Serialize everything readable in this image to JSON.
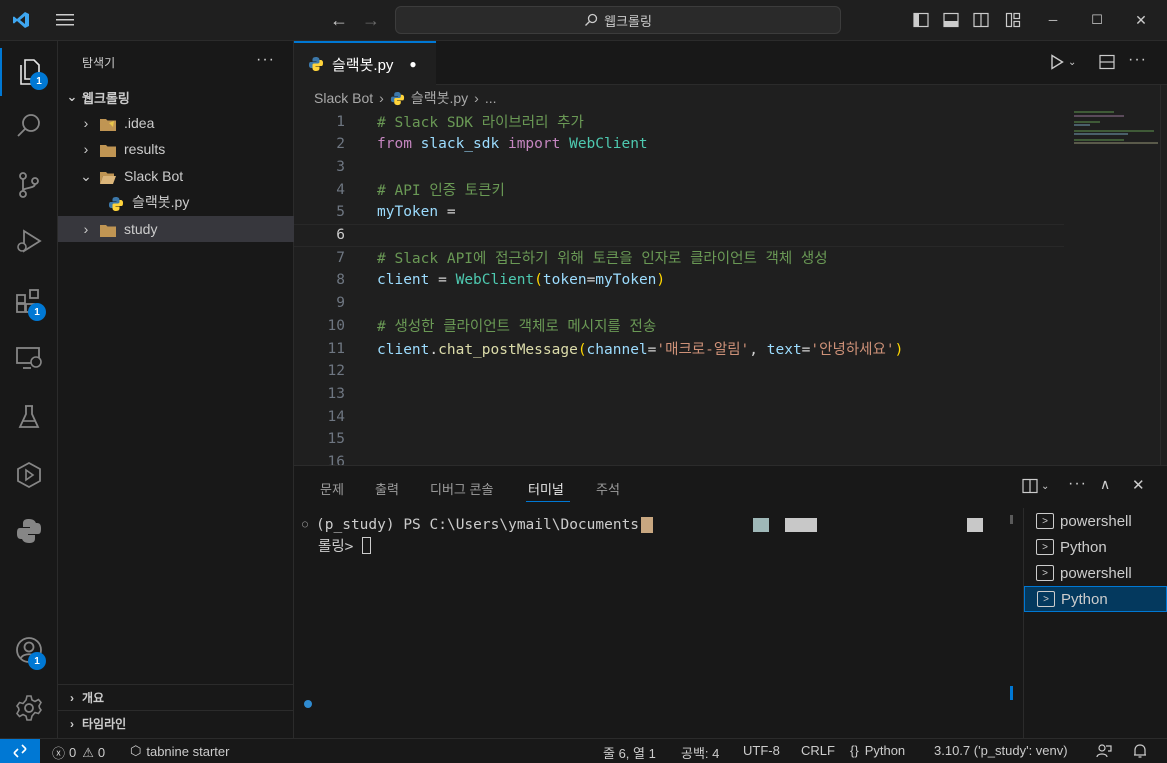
{
  "window": {
    "command_center": "웹크롤링",
    "nav_back": "←",
    "nav_forward": "→",
    "controls": {
      "minimize": "─",
      "maximize": "☐",
      "close": "✕"
    }
  },
  "activity": {
    "explorer_badge": "1",
    "extensions_badge": "1",
    "accounts_badge": "1"
  },
  "sidebar": {
    "title": "탐색기",
    "more": "···",
    "root": "웹크롤링",
    "items": [
      {
        "label": ".idea",
        "chevron": "›"
      },
      {
        "label": "results",
        "chevron": "›"
      },
      {
        "label": "Slack Bot",
        "chevron": "⌄"
      },
      {
        "label": "슬랙봇.py"
      },
      {
        "label": "study",
        "chevron": "›"
      }
    ],
    "sections": {
      "outline": "개요",
      "timeline": "타임라인"
    }
  },
  "editor": {
    "tab": {
      "label": "슬랙봇.py",
      "dirty": "●"
    },
    "breadcrumb": {
      "folder": "Slack Bot",
      "file": "슬랙봇.py",
      "more": "..."
    },
    "lines": [
      {
        "n": "1",
        "tokens": [
          [
            "cmt",
            "# Slack SDK 라이브러리 추가"
          ]
        ]
      },
      {
        "n": "2",
        "tokens": [
          [
            "kw",
            "from"
          ],
          [
            "op",
            " "
          ],
          [
            "var",
            "slack_sdk"
          ],
          [
            "op",
            " "
          ],
          [
            "kw",
            "import"
          ],
          [
            "op",
            " "
          ],
          [
            "cls",
            "WebClient"
          ]
        ]
      },
      {
        "n": "3",
        "tokens": []
      },
      {
        "n": "4",
        "tokens": [
          [
            "cmt",
            "# API 인증 토큰키"
          ]
        ]
      },
      {
        "n": "5",
        "tokens": [
          [
            "var",
            "myToken"
          ],
          [
            "op",
            " ="
          ]
        ]
      },
      {
        "n": "6",
        "tokens": []
      },
      {
        "n": "7",
        "tokens": [
          [
            "cmt",
            "# Slack API에 접근하기 위해 토큰을 인자로 클라이언트 객체 생성"
          ]
        ]
      },
      {
        "n": "8",
        "tokens": [
          [
            "var",
            "client"
          ],
          [
            "op",
            " = "
          ],
          [
            "cls",
            "WebClient"
          ],
          [
            "br",
            "("
          ],
          [
            "var",
            "token"
          ],
          [
            "op",
            "="
          ],
          [
            "var",
            "myToken"
          ],
          [
            "br",
            ")"
          ]
        ]
      },
      {
        "n": "9",
        "tokens": []
      },
      {
        "n": "10",
        "tokens": [
          [
            "cmt",
            "# 생성한 클라이언트 객체로 메시지를 전송"
          ]
        ]
      },
      {
        "n": "11",
        "tokens": [
          [
            "var",
            "client"
          ],
          [
            "op",
            "."
          ],
          [
            "fn",
            "chat_postMessage"
          ],
          [
            "br",
            "("
          ],
          [
            "var",
            "channel"
          ],
          [
            "op",
            "="
          ],
          [
            "str",
            "'매크로-알림'"
          ],
          [
            "op",
            ", "
          ],
          [
            "var",
            "text"
          ],
          [
            "op",
            "="
          ],
          [
            "str",
            "'안녕하세요'"
          ],
          [
            "br",
            ")"
          ]
        ]
      },
      {
        "n": "12",
        "tokens": []
      },
      {
        "n": "13",
        "tokens": []
      },
      {
        "n": "14",
        "tokens": []
      },
      {
        "n": "15",
        "tokens": []
      },
      {
        "n": "16",
        "tokens": []
      }
    ],
    "current_line": "6"
  },
  "panel": {
    "tabs": [
      "문제",
      "출력",
      "디버그 콘솔",
      "터미널",
      "주석"
    ],
    "active_tab": "터미널",
    "terminal_lines": [
      "(p_study) PS C:\\Users\\ymail\\Documents",
      "롤링> "
    ],
    "terminals": [
      {
        "label": "powershell",
        "type": "powershell"
      },
      {
        "label": "Python",
        "type": "python"
      },
      {
        "label": "powershell",
        "type": "powershell"
      },
      {
        "label": "Python",
        "type": "python",
        "selected": true
      }
    ]
  },
  "status": {
    "errors": "0",
    "warnings": "0",
    "tabnine": "tabnine starter",
    "position": "줄 6, 열 1",
    "indent": "공백: 4",
    "encoding": "UTF-8",
    "eol": "CRLF",
    "language": "Python",
    "interpreter": "3.10.7 ('p_study': venv)"
  },
  "colors": {
    "accent": "#0078d4",
    "comment": "#6a9955",
    "keyword": "#c586c0",
    "class": "#4ec9b0",
    "string": "#ce9178"
  }
}
